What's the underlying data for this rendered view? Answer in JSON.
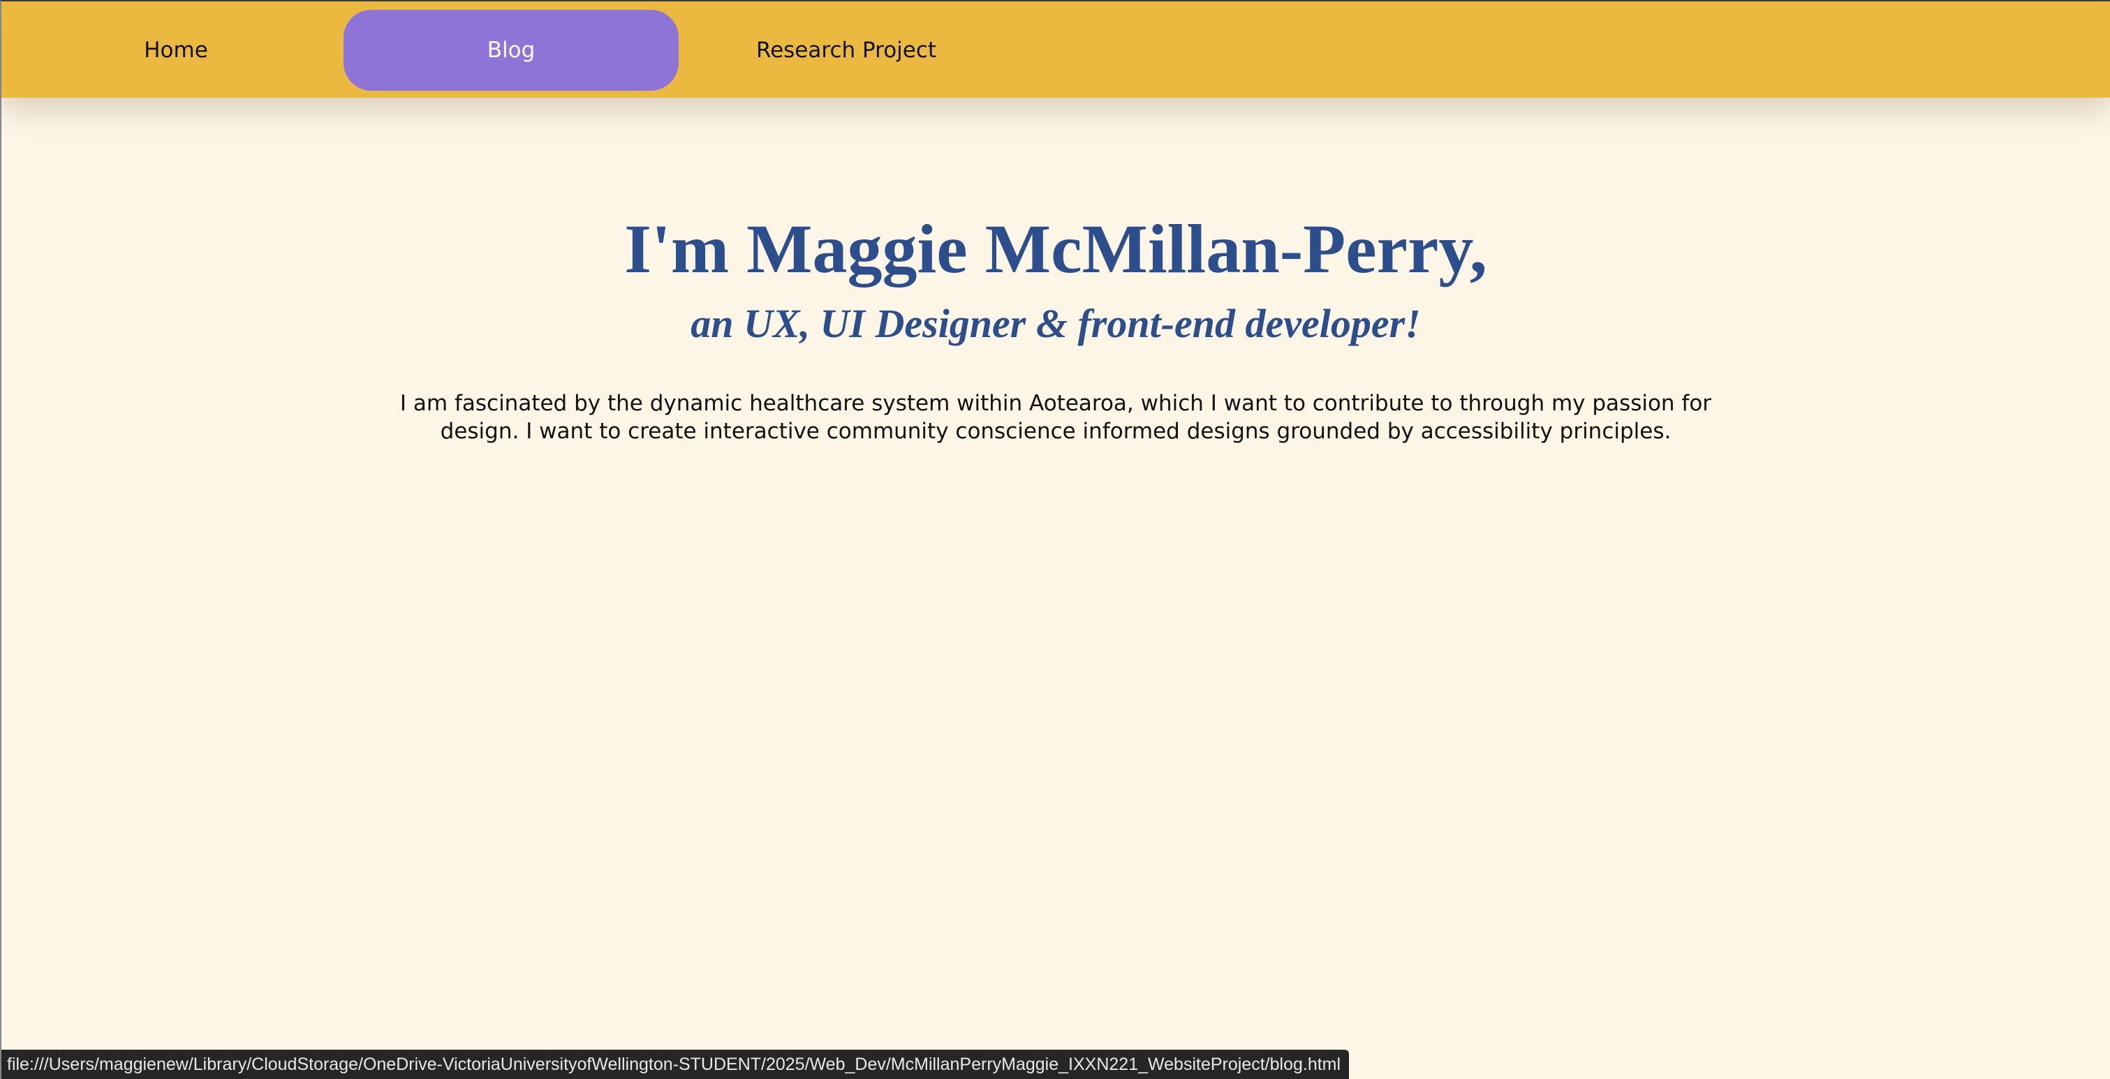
{
  "nav": {
    "items": [
      {
        "label": "Home",
        "active": false
      },
      {
        "label": "Blog",
        "active": true
      },
      {
        "label": "Research Project",
        "active": false
      }
    ]
  },
  "hero": {
    "title": "I'm Maggie McMillan-Perry,",
    "subtitle": "an UX, UI Designer & front-end developer!",
    "body": "I am fascinated by the dynamic healthcare system within Aotearoa, which I want to contribute to through my passion for design. I want to create interactive community conscience informed designs grounded by accessibility principles."
  },
  "status_bar": {
    "url": "file:///Users/maggienew/Library/CloudStorage/OneDrive-VictoriaUniversityofWellington-STUDENT/2025/Web_Dev/McMillanPerryMaggie_IXXN221_WebsiteProject/blog.html"
  },
  "colors": {
    "nav_background": "#ebb93f",
    "nav_active": "#8f74d8",
    "page_background": "#fdf6e7",
    "heading": "#2c4e8c"
  }
}
